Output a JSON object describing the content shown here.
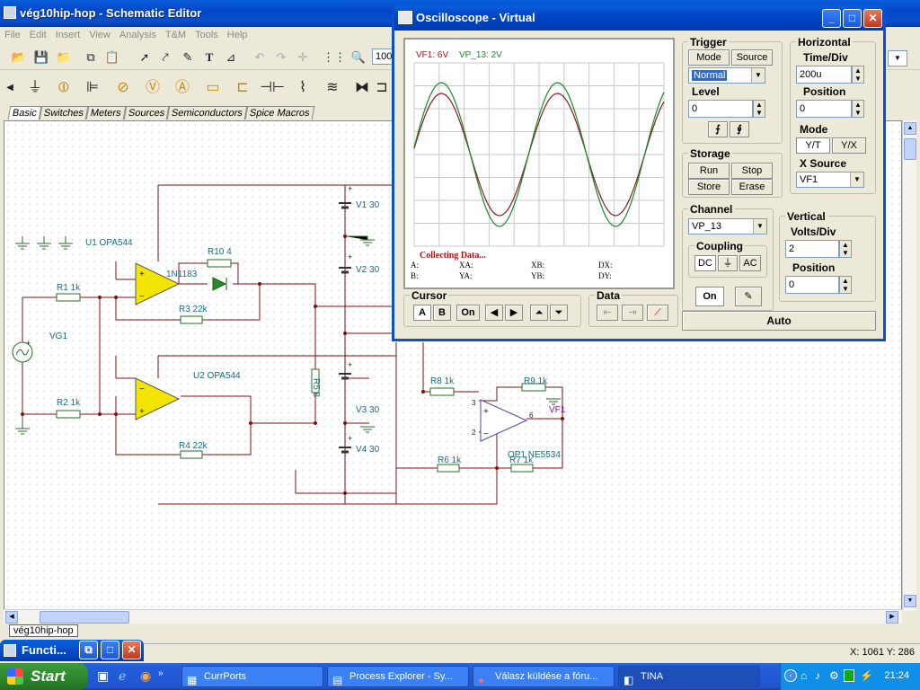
{
  "main": {
    "title": "vég10hip-hop - Schematic Editor",
    "menu": [
      "File",
      "Edit",
      "Insert",
      "View",
      "Analysis",
      "T&M",
      "Tools",
      "Help"
    ],
    "zoom": "100",
    "tabs": [
      "Basic",
      "Switches",
      "Meters",
      "Sources",
      "Semiconductors",
      "Spice Macros"
    ],
    "sheet_tab": "vég10hip-hop",
    "coords": "X: 1061  Y: 286"
  },
  "schematic": {
    "labels": [
      "U1 OPA544",
      "R1 1k",
      "R10 4",
      "1N1183",
      "R3 22k",
      "VG1",
      "U2 OPA544",
      "R2 1k",
      "R4 22k",
      "V1 30",
      "V2 30",
      "V3 30",
      "V4 30",
      "R5 8",
      "R8 1k",
      "R9 1k",
      "R6 1k",
      "R7 1k",
      "OP1 NE5534",
      "VF1",
      "3",
      "2",
      "6"
    ]
  },
  "osc": {
    "title": "Oscilloscope - Virtual",
    "legend1": "VF1: 6V",
    "legend2": "VP_13: 2V",
    "status": "Collecting Data...",
    "readouts": {
      "a": "A:",
      "b": "B:",
      "xa": "XA:",
      "ya": "YA:",
      "xb": "XB:",
      "yb": "YB:",
      "dx": "DX:",
      "dy": "DY:"
    },
    "trigger": {
      "label": "Trigger",
      "mode": "Mode",
      "source": "Source",
      "mode_value": "Normal",
      "level_label": "Level",
      "level_value": "0"
    },
    "horizontal": {
      "label": "Horizontal",
      "timediv_label": "Time/Div",
      "timediv": "200u",
      "position_label": "Position",
      "position": "0",
      "mode_label": "Mode",
      "yt": "Y/T",
      "yx": "Y/X",
      "xsource_label": "X Source",
      "xsource": "VF1"
    },
    "storage": {
      "label": "Storage",
      "run": "Run",
      "stop": "Stop",
      "store": "Store",
      "erase": "Erase"
    },
    "channel": {
      "label": "Channel",
      "value": "VP_13",
      "coupling": "Coupling",
      "dc": "DC",
      "gnd": "⏚",
      "ac": "AC",
      "on": "On"
    },
    "vertical": {
      "label": "Vertical",
      "voltsdiv_label": "Volts/Div",
      "voltsdiv": "2",
      "position_label": "Position",
      "position": "0"
    },
    "cursor": {
      "label": "Cursor",
      "a": "A",
      "b": "B",
      "on": "On"
    },
    "data_label": "Data",
    "auto": "Auto",
    "colors": {
      "vf1": "#1a8a2a",
      "vp13": "#8b1a1a",
      "screen": "#ffffff",
      "grid": "#c8c8c8"
    }
  },
  "func": {
    "title": "Functi..."
  },
  "taskbar": {
    "start": "Start",
    "tasks": [
      "CurrPorts",
      "Process Explorer - Sy...",
      "Válasz küldése a fóru...",
      "TINA"
    ],
    "clock": "21:24"
  }
}
